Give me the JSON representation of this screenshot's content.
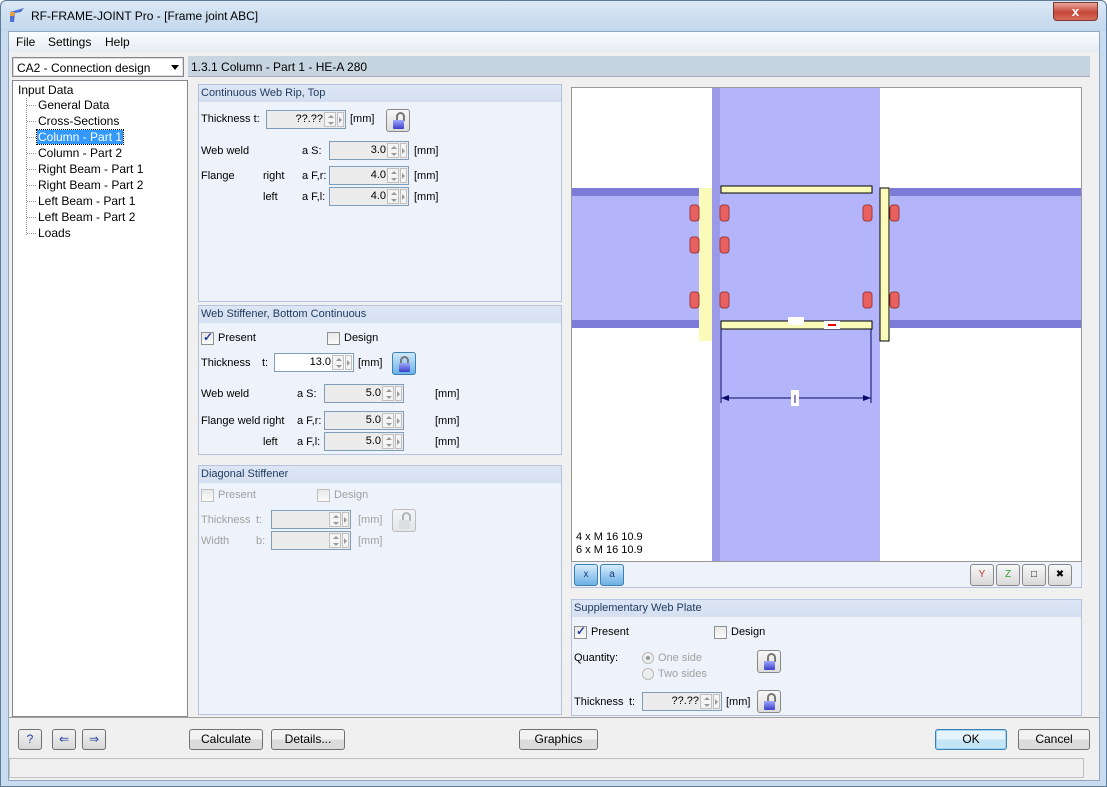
{
  "window": {
    "title": "RF-FRAME-JOINT Pro - [Frame joint ABC]",
    "close_label": "x"
  },
  "menu": [
    "File",
    "Settings",
    "Help"
  ],
  "case_selector": {
    "value": "CA2 - Connection design"
  },
  "navigator": {
    "root": "Input Data",
    "items": [
      {
        "label": "General Data",
        "selected": false
      },
      {
        "label": "Cross-Sections",
        "selected": false
      },
      {
        "label": "Column - Part 1",
        "selected": true
      },
      {
        "label": "Column - Part 2",
        "selected": false
      },
      {
        "label": "Right Beam - Part 1",
        "selected": false
      },
      {
        "label": "Right Beam - Part 2",
        "selected": false
      },
      {
        "label": "Left Beam - Part 1",
        "selected": false
      },
      {
        "label": "Left Beam - Part 2",
        "selected": false
      },
      {
        "label": "Loads",
        "selected": false
      }
    ]
  },
  "page_header": "1.3.1 Column - Part 1 - HE-A 280",
  "continuous_web_rib_top": {
    "title": "Continuous Web Rip, Top",
    "thickness_label": "Thickness t:",
    "thickness_value": "??.??",
    "unit": "[mm]",
    "web_weld_label": "Web weld",
    "web_weld_symbol": "a S:",
    "web_weld_value": "3.0",
    "flange_label": "Flange",
    "right_label": "right",
    "left_label": "left",
    "flange_right_symbol": "a F,r:",
    "flange_right_value": "4.0",
    "flange_left_symbol": "a F,l:",
    "flange_left_value": "4.0",
    "lock_state": "unlocked"
  },
  "web_stiffener_bottom": {
    "title": "Web Stiffener, Bottom Continuous",
    "present_label": "Present",
    "present_checked": true,
    "design_label": "Design",
    "design_checked": false,
    "thickness_label": "Thickness",
    "thickness_symbol": "t:",
    "thickness_value": "13.0",
    "unit": "[mm]",
    "web_weld_label": "Web weld",
    "web_weld_symbol": "a S:",
    "web_weld_value": "5.0",
    "flange_weld_label": "Flange weld",
    "right_label": "right",
    "left_label": "left",
    "flange_right_symbol": "a F,r:",
    "flange_right_value": "5.0",
    "flange_left_symbol": "a F,l:",
    "flange_left_value": "5.0",
    "lock_state": "locked"
  },
  "diagonal_stiffener": {
    "title": "Diagonal Stiffener",
    "present_label": "Present",
    "design_label": "Design",
    "thickness_label": "Thickness",
    "thickness_symbol": "t:",
    "width_label": "Width",
    "width_symbol": "b:",
    "unit": "[mm]",
    "thickness_value": "",
    "width_value": ""
  },
  "graphic": {
    "bolt_labels": [
      "4 x M 16 10.9",
      "6 x M 16 10.9"
    ],
    "dimension_label": "l",
    "colors": {
      "member": "#b4b4fa",
      "plate": "#fbfbb9",
      "bolt": "#e86060"
    }
  },
  "graphic_toolbar": {
    "left": [
      {
        "name": "dimension-x",
        "label": "x"
      },
      {
        "name": "dimension-a",
        "label": "a"
      }
    ],
    "right": [
      {
        "name": "view-y",
        "label": "Y"
      },
      {
        "name": "view-z",
        "label": "Z"
      },
      {
        "name": "isometric",
        "label": ""
      },
      {
        "name": "reset-zoom",
        "label": ""
      }
    ]
  },
  "supplementary_web_plate": {
    "title": "Supplementary Web Plate",
    "present_label": "Present",
    "present_checked": true,
    "design_label": "Design",
    "design_checked": false,
    "quantity_label": "Quantity:",
    "one_side_label": "One side",
    "two_sides_label": "Two sides",
    "selected_quantity": "One side",
    "thickness_label": "Thickness",
    "thickness_symbol": "t:",
    "thickness_value": "??.??",
    "unit": "[mm]"
  },
  "buttons": {
    "calculate": "Calculate",
    "details": "Details...",
    "graphics": "Graphics",
    "ok": "OK",
    "cancel": "Cancel"
  }
}
